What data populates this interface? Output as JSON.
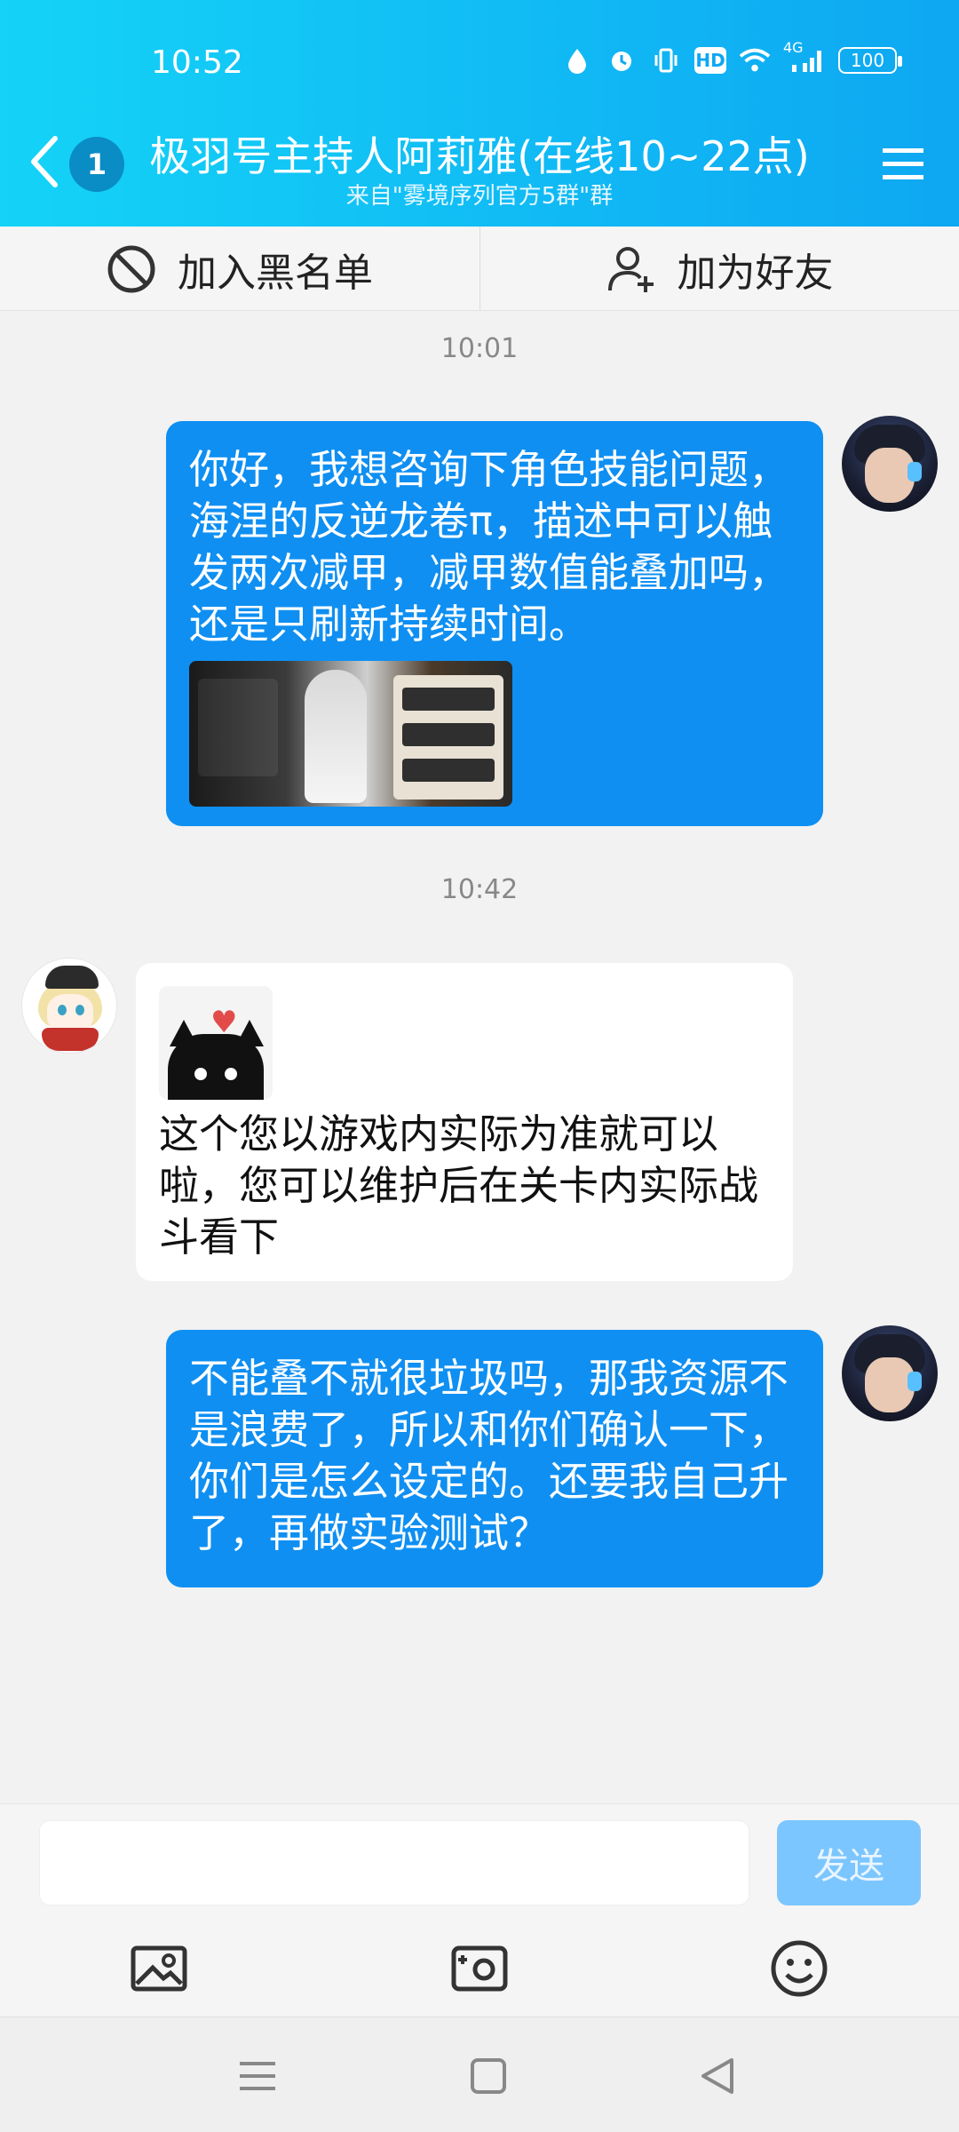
{
  "status_bar": {
    "time": "10:52",
    "battery": "100",
    "hd": "HD",
    "network": "4G"
  },
  "header": {
    "unread_count": "1",
    "title": "极羽号主持人阿莉雅(在线10~22点)",
    "subtitle": "来自\"雾境序列官方5群\"群"
  },
  "actions": {
    "blacklist": "加入黑名单",
    "add_friend": "加为好友"
  },
  "messages": [
    {
      "time": "10:01"
    },
    {
      "sender": "me",
      "text": "你好，我想咨询下角色技能问题，海涅的反逆龙卷π，描述中可以触发两次减甲，减甲数值能叠加吗，还是只刷新持续时间。",
      "has_image": true
    },
    {
      "time": "10:42"
    },
    {
      "sender": "other",
      "text": "这个您以游戏内实际为准就可以啦，您可以维护后在关卡内实际战斗看下",
      "has_sticker": true
    },
    {
      "sender": "me",
      "text": "不能叠不就很垃圾吗，那我资源不是浪费了，所以和你们确认一下，你们是怎么设定的。还要我自己升了，再做实验测试？"
    }
  ],
  "input": {
    "placeholder": "",
    "send_label": "发送"
  },
  "colors": {
    "header_start": "#14d3f7",
    "header_end": "#0ea7f2",
    "bubble_out": "#0f8ff2",
    "bubble_in": "#ffffff",
    "send_disabled": "#7cc6ff"
  },
  "icons": [
    "back-arrow-icon",
    "menu-icon",
    "block-icon",
    "add-friend-icon",
    "photo-icon",
    "camera-icon",
    "emoji-icon",
    "nav-menu-icon",
    "nav-home-icon",
    "nav-back-icon"
  ]
}
